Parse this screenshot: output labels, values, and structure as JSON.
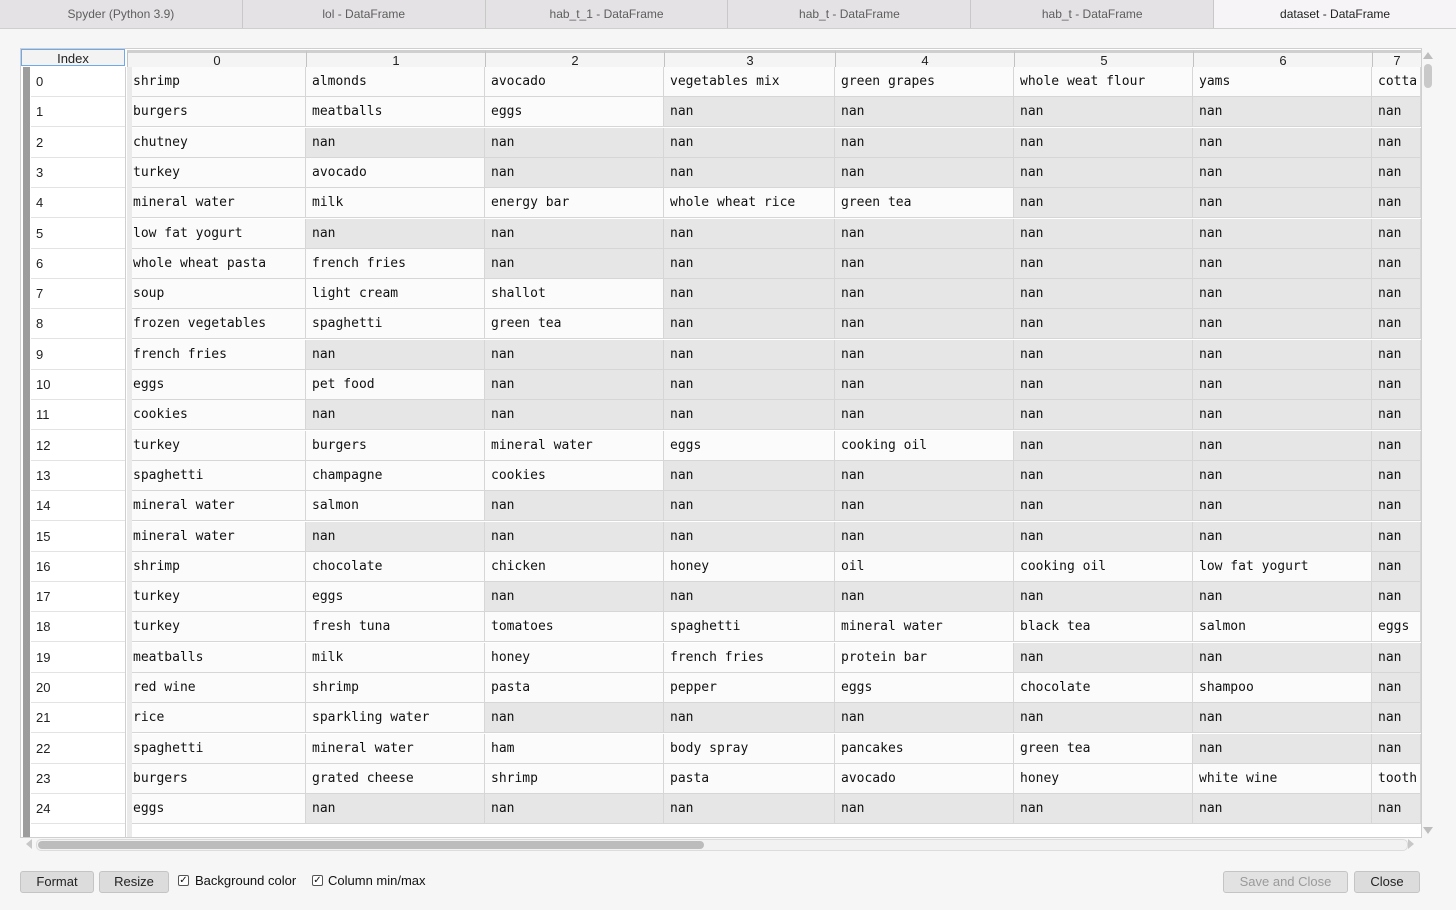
{
  "tabs": [
    {
      "label": "Spyder (Python 3.9)",
      "active": false
    },
    {
      "label": "lol - DataFrame",
      "active": false
    },
    {
      "label": "hab_t_1 - DataFrame",
      "active": false
    },
    {
      "label": "hab_t - DataFrame",
      "active": false
    },
    {
      "label": "hab_t - DataFrame",
      "active": false
    },
    {
      "label": "dataset - DataFrame",
      "active": true
    }
  ],
  "table": {
    "index_header": "Index",
    "columns": [
      "0",
      "1",
      "2",
      "3",
      "4",
      "5",
      "6",
      "7"
    ],
    "rows": [
      {
        "index": "0",
        "cells": [
          "shrimp",
          "almonds",
          "avocado",
          "vegetables mix",
          "green grapes",
          "whole weat flour",
          "yams",
          "cotta"
        ]
      },
      {
        "index": "1",
        "cells": [
          "burgers",
          "meatballs",
          "eggs",
          "nan",
          "nan",
          "nan",
          "nan",
          "nan"
        ]
      },
      {
        "index": "2",
        "cells": [
          "chutney",
          "nan",
          "nan",
          "nan",
          "nan",
          "nan",
          "nan",
          "nan"
        ]
      },
      {
        "index": "3",
        "cells": [
          "turkey",
          "avocado",
          "nan",
          "nan",
          "nan",
          "nan",
          "nan",
          "nan"
        ]
      },
      {
        "index": "4",
        "cells": [
          "mineral water",
          "milk",
          "energy bar",
          "whole wheat rice",
          "green tea",
          "nan",
          "nan",
          "nan"
        ]
      },
      {
        "index": "5",
        "cells": [
          "low fat yogurt",
          "nan",
          "nan",
          "nan",
          "nan",
          "nan",
          "nan",
          "nan"
        ]
      },
      {
        "index": "6",
        "cells": [
          "whole wheat pasta",
          "french fries",
          "nan",
          "nan",
          "nan",
          "nan",
          "nan",
          "nan"
        ]
      },
      {
        "index": "7",
        "cells": [
          "soup",
          "light cream",
          "shallot",
          "nan",
          "nan",
          "nan",
          "nan",
          "nan"
        ]
      },
      {
        "index": "8",
        "cells": [
          "frozen vegetables",
          "spaghetti",
          "green tea",
          "nan",
          "nan",
          "nan",
          "nan",
          "nan"
        ]
      },
      {
        "index": "9",
        "cells": [
          "french fries",
          "nan",
          "nan",
          "nan",
          "nan",
          "nan",
          "nan",
          "nan"
        ]
      },
      {
        "index": "10",
        "cells": [
          "eggs",
          "pet food",
          "nan",
          "nan",
          "nan",
          "nan",
          "nan",
          "nan"
        ]
      },
      {
        "index": "11",
        "cells": [
          "cookies",
          "nan",
          "nan",
          "nan",
          "nan",
          "nan",
          "nan",
          "nan"
        ]
      },
      {
        "index": "12",
        "cells": [
          "turkey",
          "burgers",
          "mineral water",
          "eggs",
          "cooking oil",
          "nan",
          "nan",
          "nan"
        ]
      },
      {
        "index": "13",
        "cells": [
          "spaghetti",
          "champagne",
          "cookies",
          "nan",
          "nan",
          "nan",
          "nan",
          "nan"
        ]
      },
      {
        "index": "14",
        "cells": [
          "mineral water",
          "salmon",
          "nan",
          "nan",
          "nan",
          "nan",
          "nan",
          "nan"
        ]
      },
      {
        "index": "15",
        "cells": [
          "mineral water",
          "nan",
          "nan",
          "nan",
          "nan",
          "nan",
          "nan",
          "nan"
        ]
      },
      {
        "index": "16",
        "cells": [
          "shrimp",
          "chocolate",
          "chicken",
          "honey",
          "oil",
          "cooking oil",
          "low fat yogurt",
          "nan"
        ]
      },
      {
        "index": "17",
        "cells": [
          "turkey",
          "eggs",
          "nan",
          "nan",
          "nan",
          "nan",
          "nan",
          "nan"
        ]
      },
      {
        "index": "18",
        "cells": [
          "turkey",
          "fresh tuna",
          "tomatoes",
          "spaghetti",
          "mineral water",
          "black tea",
          "salmon",
          "eggs"
        ]
      },
      {
        "index": "19",
        "cells": [
          "meatballs",
          "milk",
          "honey",
          "french fries",
          "protein bar",
          "nan",
          "nan",
          "nan"
        ]
      },
      {
        "index": "20",
        "cells": [
          "red wine",
          "shrimp",
          "pasta",
          "pepper",
          "eggs",
          "chocolate",
          "shampoo",
          "nan"
        ]
      },
      {
        "index": "21",
        "cells": [
          "rice",
          "sparkling water",
          "nan",
          "nan",
          "nan",
          "nan",
          "nan",
          "nan"
        ]
      },
      {
        "index": "22",
        "cells": [
          "spaghetti",
          "mineral water",
          "ham",
          "body spray",
          "pancakes",
          "green tea",
          "nan",
          "nan"
        ]
      },
      {
        "index": "23",
        "cells": [
          "burgers",
          "grated cheese",
          "shrimp",
          "pasta",
          "avocado",
          "honey",
          "white wine",
          "tooth"
        ]
      },
      {
        "index": "24",
        "cells": [
          "eggs",
          "nan",
          "nan",
          "nan",
          "nan",
          "nan",
          "nan",
          "nan"
        ]
      }
    ]
  },
  "bottom_bar": {
    "format_label": "Format",
    "resize_label": "Resize",
    "bg_color": {
      "label": "Background color",
      "checked": true
    },
    "col_minmax": {
      "label": "Column min/max",
      "checked": true
    },
    "save_close_label": "Save and Close",
    "close_label": "Close"
  },
  "colors": {
    "nan_cell": "#e6e6e6",
    "value_cell": "#fbfbfb",
    "active_header_border": "#6fa9ea"
  }
}
